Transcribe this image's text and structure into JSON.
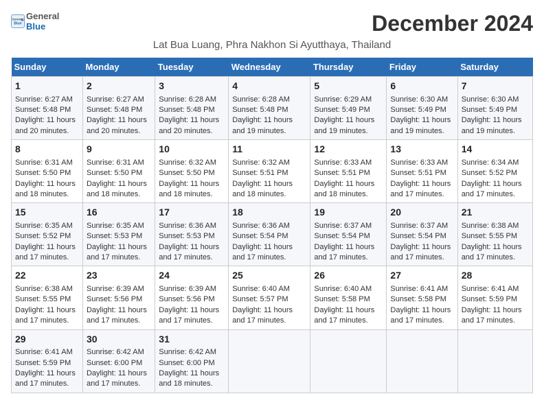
{
  "logo": {
    "general": "General",
    "blue": "Blue"
  },
  "header": {
    "month_title": "December 2024",
    "location": "Lat Bua Luang, Phra Nakhon Si Ayutthaya, Thailand"
  },
  "weekdays": [
    "Sunday",
    "Monday",
    "Tuesday",
    "Wednesday",
    "Thursday",
    "Friday",
    "Saturday"
  ],
  "weeks": [
    [
      {
        "day": "1",
        "sunrise": "Sunrise: 6:27 AM",
        "sunset": "Sunset: 5:48 PM",
        "daylight": "Daylight: 11 hours and 20 minutes."
      },
      {
        "day": "2",
        "sunrise": "Sunrise: 6:27 AM",
        "sunset": "Sunset: 5:48 PM",
        "daylight": "Daylight: 11 hours and 20 minutes."
      },
      {
        "day": "3",
        "sunrise": "Sunrise: 6:28 AM",
        "sunset": "Sunset: 5:48 PM",
        "daylight": "Daylight: 11 hours and 20 minutes."
      },
      {
        "day": "4",
        "sunrise": "Sunrise: 6:28 AM",
        "sunset": "Sunset: 5:48 PM",
        "daylight": "Daylight: 11 hours and 19 minutes."
      },
      {
        "day": "5",
        "sunrise": "Sunrise: 6:29 AM",
        "sunset": "Sunset: 5:49 PM",
        "daylight": "Daylight: 11 hours and 19 minutes."
      },
      {
        "day": "6",
        "sunrise": "Sunrise: 6:30 AM",
        "sunset": "Sunset: 5:49 PM",
        "daylight": "Daylight: 11 hours and 19 minutes."
      },
      {
        "day": "7",
        "sunrise": "Sunrise: 6:30 AM",
        "sunset": "Sunset: 5:49 PM",
        "daylight": "Daylight: 11 hours and 19 minutes."
      }
    ],
    [
      {
        "day": "8",
        "sunrise": "Sunrise: 6:31 AM",
        "sunset": "Sunset: 5:50 PM",
        "daylight": "Daylight: 11 hours and 18 minutes."
      },
      {
        "day": "9",
        "sunrise": "Sunrise: 6:31 AM",
        "sunset": "Sunset: 5:50 PM",
        "daylight": "Daylight: 11 hours and 18 minutes."
      },
      {
        "day": "10",
        "sunrise": "Sunrise: 6:32 AM",
        "sunset": "Sunset: 5:50 PM",
        "daylight": "Daylight: 11 hours and 18 minutes."
      },
      {
        "day": "11",
        "sunrise": "Sunrise: 6:32 AM",
        "sunset": "Sunset: 5:51 PM",
        "daylight": "Daylight: 11 hours and 18 minutes."
      },
      {
        "day": "12",
        "sunrise": "Sunrise: 6:33 AM",
        "sunset": "Sunset: 5:51 PM",
        "daylight": "Daylight: 11 hours and 18 minutes."
      },
      {
        "day": "13",
        "sunrise": "Sunrise: 6:33 AM",
        "sunset": "Sunset: 5:51 PM",
        "daylight": "Daylight: 11 hours and 17 minutes."
      },
      {
        "day": "14",
        "sunrise": "Sunrise: 6:34 AM",
        "sunset": "Sunset: 5:52 PM",
        "daylight": "Daylight: 11 hours and 17 minutes."
      }
    ],
    [
      {
        "day": "15",
        "sunrise": "Sunrise: 6:35 AM",
        "sunset": "Sunset: 5:52 PM",
        "daylight": "Daylight: 11 hours and 17 minutes."
      },
      {
        "day": "16",
        "sunrise": "Sunrise: 6:35 AM",
        "sunset": "Sunset: 5:53 PM",
        "daylight": "Daylight: 11 hours and 17 minutes."
      },
      {
        "day": "17",
        "sunrise": "Sunrise: 6:36 AM",
        "sunset": "Sunset: 5:53 PM",
        "daylight": "Daylight: 11 hours and 17 minutes."
      },
      {
        "day": "18",
        "sunrise": "Sunrise: 6:36 AM",
        "sunset": "Sunset: 5:54 PM",
        "daylight": "Daylight: 11 hours and 17 minutes."
      },
      {
        "day": "19",
        "sunrise": "Sunrise: 6:37 AM",
        "sunset": "Sunset: 5:54 PM",
        "daylight": "Daylight: 11 hours and 17 minutes."
      },
      {
        "day": "20",
        "sunrise": "Sunrise: 6:37 AM",
        "sunset": "Sunset: 5:54 PM",
        "daylight": "Daylight: 11 hours and 17 minutes."
      },
      {
        "day": "21",
        "sunrise": "Sunrise: 6:38 AM",
        "sunset": "Sunset: 5:55 PM",
        "daylight": "Daylight: 11 hours and 17 minutes."
      }
    ],
    [
      {
        "day": "22",
        "sunrise": "Sunrise: 6:38 AM",
        "sunset": "Sunset: 5:55 PM",
        "daylight": "Daylight: 11 hours and 17 minutes."
      },
      {
        "day": "23",
        "sunrise": "Sunrise: 6:39 AM",
        "sunset": "Sunset: 5:56 PM",
        "daylight": "Daylight: 11 hours and 17 minutes."
      },
      {
        "day": "24",
        "sunrise": "Sunrise: 6:39 AM",
        "sunset": "Sunset: 5:56 PM",
        "daylight": "Daylight: 11 hours and 17 minutes."
      },
      {
        "day": "25",
        "sunrise": "Sunrise: 6:40 AM",
        "sunset": "Sunset: 5:57 PM",
        "daylight": "Daylight: 11 hours and 17 minutes."
      },
      {
        "day": "26",
        "sunrise": "Sunrise: 6:40 AM",
        "sunset": "Sunset: 5:58 PM",
        "daylight": "Daylight: 11 hours and 17 minutes."
      },
      {
        "day": "27",
        "sunrise": "Sunrise: 6:41 AM",
        "sunset": "Sunset: 5:58 PM",
        "daylight": "Daylight: 11 hours and 17 minutes."
      },
      {
        "day": "28",
        "sunrise": "Sunrise: 6:41 AM",
        "sunset": "Sunset: 5:59 PM",
        "daylight": "Daylight: 11 hours and 17 minutes."
      }
    ],
    [
      {
        "day": "29",
        "sunrise": "Sunrise: 6:41 AM",
        "sunset": "Sunset: 5:59 PM",
        "daylight": "Daylight: 11 hours and 17 minutes."
      },
      {
        "day": "30",
        "sunrise": "Sunrise: 6:42 AM",
        "sunset": "Sunset: 6:00 PM",
        "daylight": "Daylight: 11 hours and 17 minutes."
      },
      {
        "day": "31",
        "sunrise": "Sunrise: 6:42 AM",
        "sunset": "Sunset: 6:00 PM",
        "daylight": "Daylight: 11 hours and 18 minutes."
      },
      null,
      null,
      null,
      null
    ]
  ]
}
